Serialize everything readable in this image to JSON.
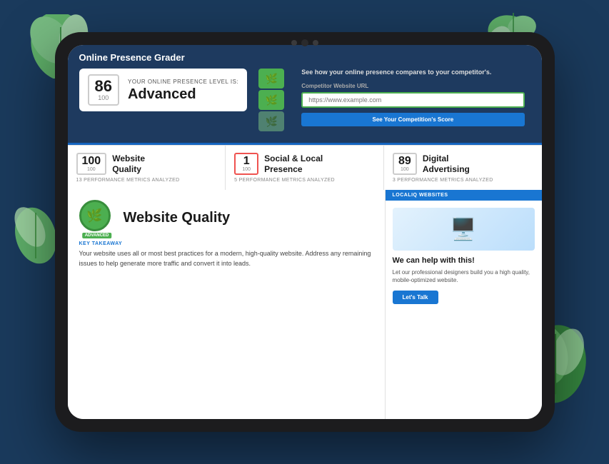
{
  "app": {
    "title": "Online Presence Grader"
  },
  "hero": {
    "score": "86",
    "score_total": "100",
    "level_label": "YOUR ONLINE PRESENCE LEVEL IS:",
    "level": "Advanced",
    "competitor_section": {
      "title": "See how your online presence compares to your competitor's.",
      "url_label": "Competitor Website URL",
      "url_placeholder": "https://www.example.com",
      "button_label": "See Your Competition's Score"
    }
  },
  "metrics": [
    {
      "score": "100",
      "total": "100",
      "name": "Website Quality",
      "sub": "13 PERFORMANCE METRICS ANALYZED",
      "red": false
    },
    {
      "score": "1",
      "total": "100",
      "name": "Social & Local Presence",
      "sub": "5 PERFORMANCE METRICS ANALYZED",
      "red": true
    },
    {
      "score": "89",
      "total": "100",
      "name": "Digital Advertising",
      "sub": "3 PERFORMANCE METRICS ANALYZED",
      "red": false
    }
  ],
  "website_quality": {
    "badge_label": "ADVANCED",
    "title": "Website Quality",
    "key_takeaway_label": "KEY TAKEAWAY",
    "key_takeaway_text": "Your website uses all or most best practices for a modern, high-quality website. Address any remaining issues to help generate more traffic and convert it into leads."
  },
  "help_card": {
    "brand": "LOCALIQ WEBSITES",
    "title": "We can help with this!",
    "desc": "Let our professional designers build you a high quality, mobile-optimized website.",
    "button_label": "Let's Talk"
  }
}
